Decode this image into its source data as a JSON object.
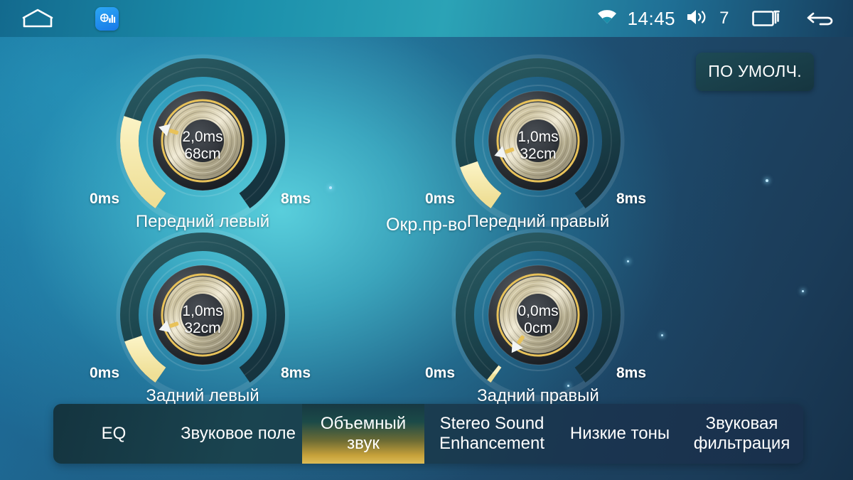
{
  "statusbar": {
    "home_icon": "home-icon",
    "app_icon": "equalizer-app-icon",
    "wifi_icon": "wifi-icon",
    "time": "14:45",
    "volume_icon": "volume-icon",
    "volume_level": "7",
    "recents_icon": "recent-apps-icon",
    "back_icon": "back-arrow-icon"
  },
  "default_button": {
    "label": "ПО УМОЛЧ."
  },
  "center_label": "Окр.пр-во",
  "knobs": [
    {
      "name": "Передний левый",
      "ms": "2,0ms",
      "cm": "68cm",
      "min": "0ms",
      "max": "8ms",
      "value": 2.0,
      "max_value": 8
    },
    {
      "name": "Передний правый",
      "ms": "1,0ms",
      "cm": "32cm",
      "min": "0ms",
      "max": "8ms",
      "value": 1.0,
      "max_value": 8
    },
    {
      "name": "Задний левый",
      "ms": "1,0ms",
      "cm": "32cm",
      "min": "0ms",
      "max": "8ms",
      "value": 1.0,
      "max_value": 8
    },
    {
      "name": "Задний правый",
      "ms": "0,0ms",
      "cm": "0cm",
      "min": "0ms",
      "max": "8ms",
      "value": 0.0,
      "max_value": 8
    }
  ],
  "tabs": [
    {
      "label": "EQ",
      "active": false
    },
    {
      "label": "Звуковое поле",
      "active": false
    },
    {
      "label": "Объемный звук",
      "active": true
    },
    {
      "label": "Stereo Sound Enhancement",
      "active": false
    },
    {
      "label": "Низкие тоны",
      "active": false
    },
    {
      "label": "Звуковая фильтрация",
      "active": false
    }
  ],
  "colors": {
    "accent_yellow": "#f5e8a8",
    "track_dark": "#1c4550",
    "active_tab_gold": "#d4aa3a",
    "status_bar_teal": "#1b8fab",
    "text_white": "#ffffff"
  }
}
